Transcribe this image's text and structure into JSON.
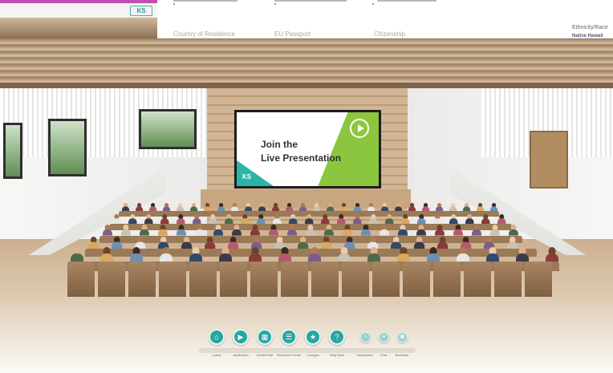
{
  "form": {
    "fields": [
      "Country of Residence",
      "EU Passport",
      "Citizenship"
    ],
    "right_label": "Ethnicity/Race",
    "right_value": "Native Hawaii"
  },
  "thumbnail": {
    "logo_text": "KS"
  },
  "screen": {
    "title_line1": "Join the",
    "title_line2": "Live Presentation",
    "logo_text": "KS"
  },
  "toolbar": {
    "buttons": [
      {
        "icon": "lobby-icon",
        "label": "Lobby"
      },
      {
        "icon": "play-icon",
        "label": "Auditorium"
      },
      {
        "icon": "exhibit-hall-icon",
        "label": "Exhibit Hall"
      },
      {
        "icon": "resource-center-icon",
        "label": "Resource Center"
      },
      {
        "icon": "star-icon",
        "label": "Lounges"
      },
      {
        "icon": "help-desk-icon",
        "label": "Help Desk"
      },
      {
        "icon": "info-icon",
        "label": "Information"
      },
      {
        "icon": "chat-icon",
        "label": "Chat"
      },
      {
        "icon": "briefcase-icon",
        "label": "Briefcase"
      }
    ]
  },
  "colors": {
    "accent": "#2aa6a0",
    "brand_green": "#8cc63f",
    "magenta_bar": "#c24fb0"
  }
}
